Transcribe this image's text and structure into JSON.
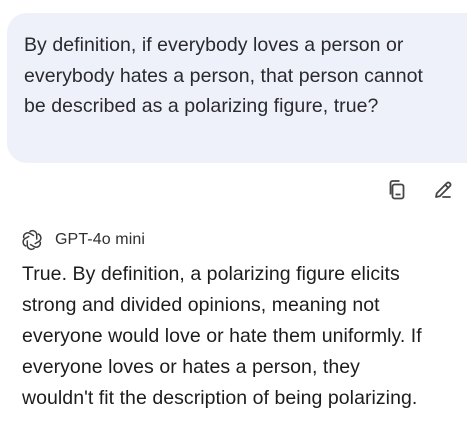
{
  "user_message": {
    "text": "By definition, if everybody loves a person  or everybody hates a person, that person cannot be described as a polarizing figure, true?"
  },
  "actions": {
    "copy_icon": "copy-icon",
    "edit_icon": "edit-pencil-icon"
  },
  "assistant": {
    "model_icon": "openai-logo-icon",
    "model_name": "GPT-4o mini",
    "lines": [
      "True. By definition, a polarizing figure elicits",
      "strong and divided opinions, meaning not",
      "everyone would love or hate them uniformly. If",
      "everyone loves or hates a person, they",
      "wouldn't fit the description of being polarizing."
    ]
  },
  "colors": {
    "bubble_bg": "#eef0fa",
    "text": "#1f1f1f",
    "icon": "#444746"
  }
}
